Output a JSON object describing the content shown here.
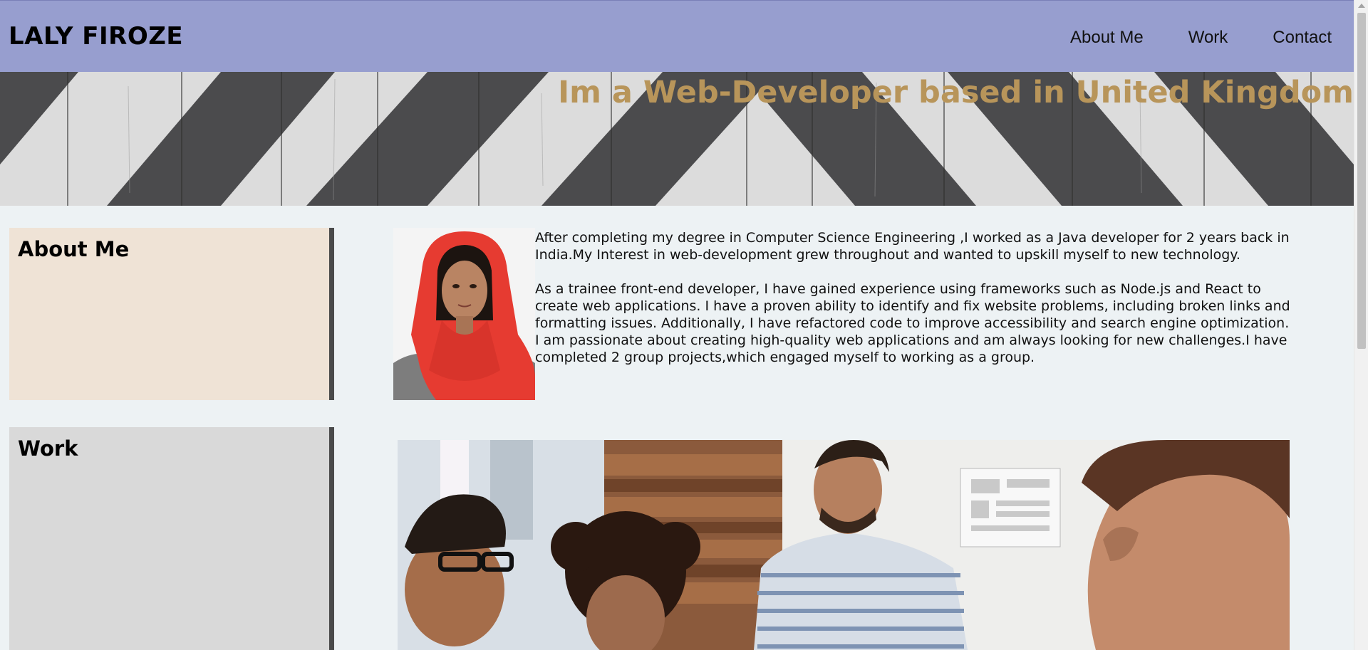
{
  "header": {
    "logo": "LALY FIROZE",
    "nav": [
      {
        "label": "About Me"
      },
      {
        "label": "Work"
      },
      {
        "label": "Contact"
      }
    ]
  },
  "hero": {
    "title": "Im a Web-Developer based in United Kingdom"
  },
  "about": {
    "heading": "About Me",
    "paragraphs": [
      "After completing my degree in Computer Science Engineering ,I worked as a Java developer for 2 years back in India.My Interest in web-development grew throughout and wanted to upskill myself to new technology.",
      "As a trainee front-end developer, I have gained experience using frameworks such as Node.js and React to create web applications. I have a proven ability to identify and fix website problems, including broken links and formatting issues. Additionally, I have refactored code to improve accessibility and search engine optimization. I am passionate about creating high-quality web applications and am always looking for new challenges.I have completed 2 group projects,which engaged myself to working as a group."
    ]
  },
  "work": {
    "heading": "Work"
  },
  "colors": {
    "header_bg": "#979ecf",
    "hero_title": "#b8955a",
    "about_card": "#efe3d6",
    "work_card": "#d9d9d9",
    "page_bg": "#edf2f4"
  }
}
